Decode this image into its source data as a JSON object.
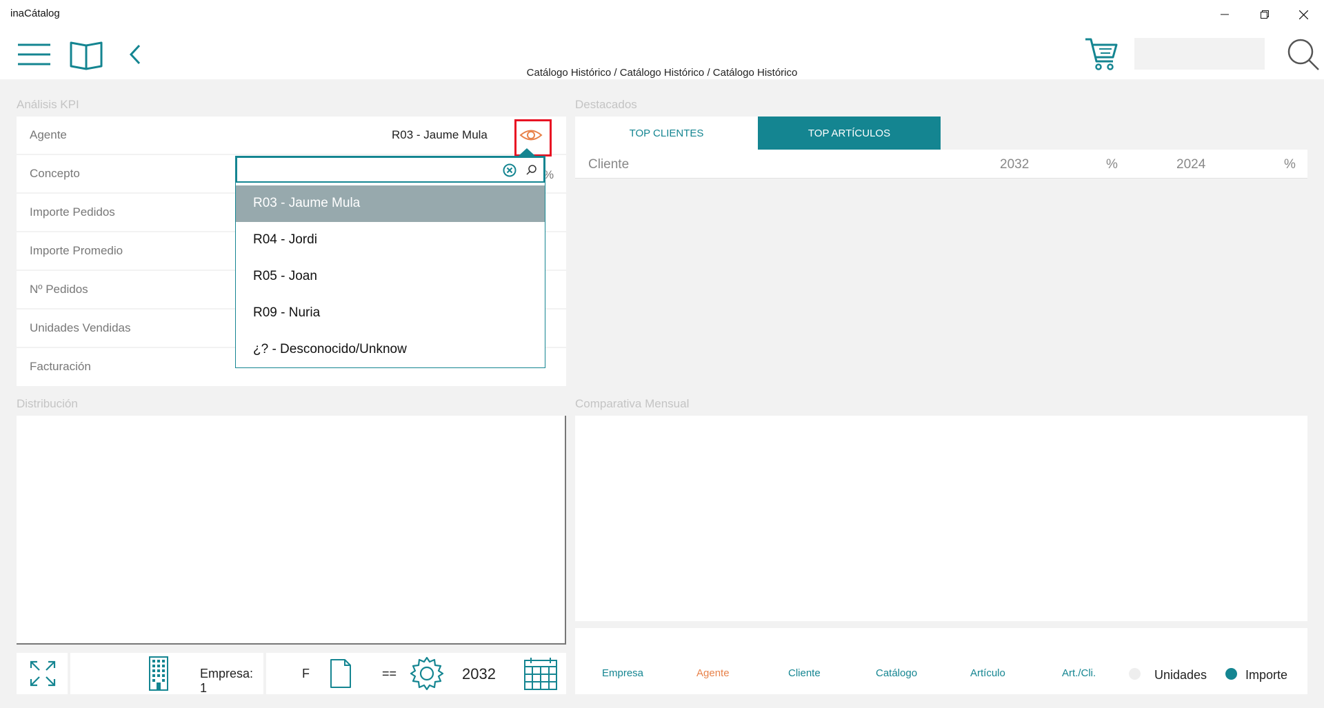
{
  "window": {
    "title": "inaCátalog",
    "controls": [
      "minimize-icon",
      "restore-icon",
      "close-icon"
    ]
  },
  "toolbar": {
    "icons": [
      "menu-icon",
      "book-icon",
      "back-icon",
      "cart-icon",
      "search-icon"
    ],
    "breadcrumb": "Catálogo Histórico / Catálogo Histórico / Catálogo Histórico",
    "search_value": ""
  },
  "kpi": {
    "section_label": "Análisis KPI",
    "agent_label": "Agente",
    "agent_value": "R03 - Jaume Mula",
    "rows": [
      "Concepto",
      "Importe Pedidos",
      "Importe Promedio",
      "Nº Pedidos",
      "Unidades Vendidas",
      "Facturación"
    ],
    "concepto_suffix": "%"
  },
  "agent_dropdown": {
    "search_value": "",
    "selected_index": 0,
    "options": [
      "R03 - Jaume Mula",
      "R04 - Jordi",
      "R05 - Joan",
      "R09 - Nuria",
      "¿? - Desconocido/Unknow"
    ]
  },
  "destacados": {
    "section_label": "Destacados",
    "tabs": [
      "TOP CLIENTES",
      "TOP ARTÍCULOS"
    ],
    "active_tab": 1,
    "columns": [
      "Cliente",
      "2032",
      "%",
      "2024",
      "%"
    ]
  },
  "distribucion": {
    "section_label": "Distribución"
  },
  "comparativa": {
    "section_label": "Comparativa Mensual"
  },
  "bottom_left": {
    "empresa": "Empresa: 1",
    "f_label": "F",
    "eq_label": "==",
    "year": "2032"
  },
  "bottom_right": {
    "groups": [
      "Empresa",
      "Agente",
      "Cliente",
      "Catálogo",
      "Artículo",
      "Art./Cli."
    ],
    "active_group": 1,
    "radios": [
      {
        "label": "Unidades",
        "checked": false
      },
      {
        "label": "Importe",
        "checked": true
      }
    ]
  },
  "colors": {
    "accent": "#148591",
    "orange": "#e8824a",
    "highlight_red": "#e81123",
    "selected_row": "#97a9ad"
  }
}
